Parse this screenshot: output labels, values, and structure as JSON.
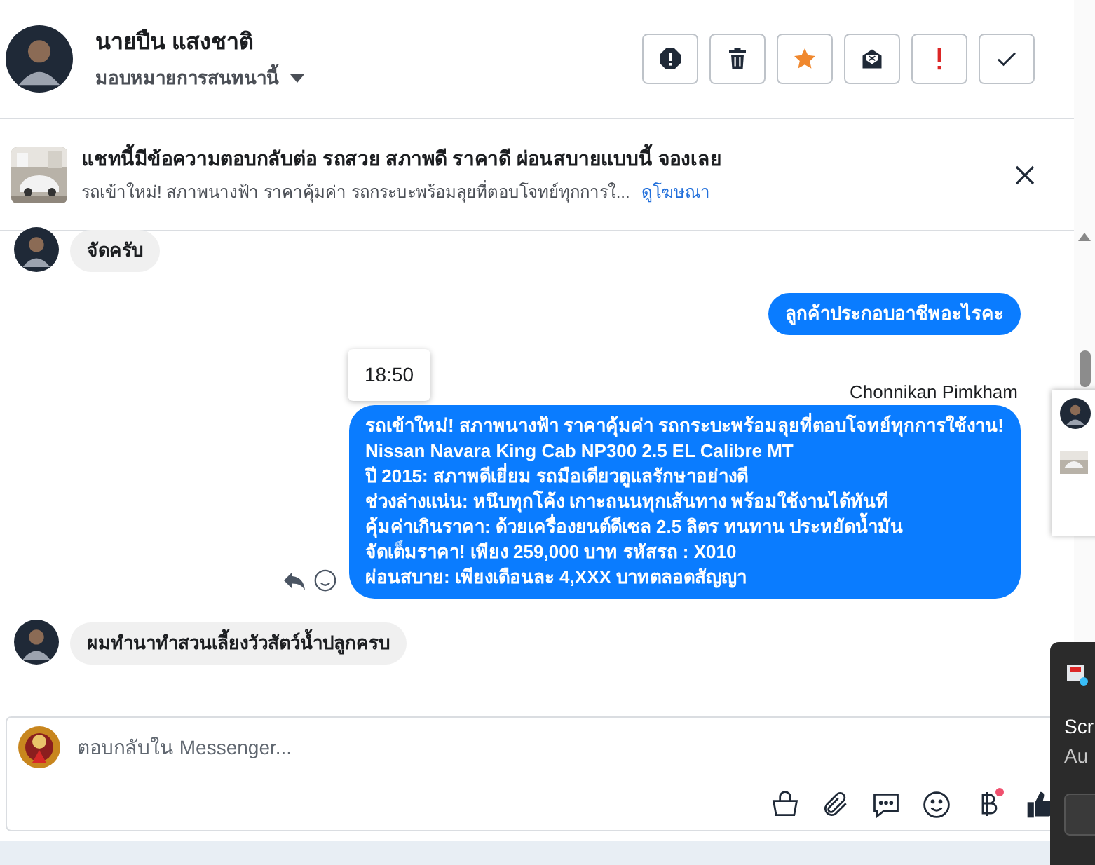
{
  "header": {
    "name": "นายปืน แสงชาติ",
    "assign": "มอบหมายการสนทนานี้"
  },
  "actions": [
    {
      "kind": "spam"
    },
    {
      "kind": "delete"
    },
    {
      "kind": "star"
    },
    {
      "kind": "unread"
    },
    {
      "kind": "important"
    },
    {
      "kind": "done"
    }
  ],
  "ad": {
    "title": "แชทนี้มีข้อความตอบกลับต่อ รถสวย สภาพดี ราคาดี ผ่อนสบายแบบนี้ จองเลย",
    "body": "รถเข้าใหม่! สภาพนางฟ้า ราคาคุ้มค่า รถกระบะพร้อมลุยที่ตอบโจทย์ทุกการใ...",
    "link": "ดูโฆษณา"
  },
  "messages": [
    {
      "outgoing": false,
      "lines": [
        "จัดครับ"
      ]
    },
    {
      "outgoing": true,
      "lines": [
        "ลูกค้าประกอบอาชีพอะไรคะ"
      ]
    },
    {
      "outgoing": true,
      "time": "18:50",
      "sender": "Chonnikan Pimkham",
      "lines": [
        "รถเข้าใหม่! สภาพนางฟ้า ราคาคุ้มค่า รถกระบะพร้อมลุยที่ตอบโจทย์ทุกการใช้งาน!",
        "Nissan Navara King Cab NP300 2.5 EL Calibre MT",
        "ปี 2015: สภาพดีเยี่ยม รถมือเดียวดูแลรักษาอย่างดี",
        "ช่วงล่างแน่น: หนึบทุกโค้ง เกาะถนนทุกเส้นทาง พร้อมใช้งานได้ทันที",
        "คุ้มค่าเกินราคา: ด้วยเครื่องยนต์ดีเซล 2.5 ลิตร ทนทาน ประหยัดน้ำมัน",
        "จัดเต็มราคา! เพียง 259,000 บาท  รหัสรถ : X010",
        "ผ่อนสบาย: เพียงเดือนละ 4,XXX บาทตลอดสัญญา"
      ]
    },
    {
      "outgoing": false,
      "lines": [
        "ผมทำนาทำสวนเลี้ยงวัวสัตว์น้ำปลูกครบ"
      ]
    }
  ],
  "composer": {
    "placeholder": "ตอบกลับใน Messenger...",
    "tools": [
      {
        "kind": "bag"
      },
      {
        "kind": "clip"
      },
      {
        "kind": "chat"
      },
      {
        "kind": "smile"
      },
      {
        "kind": "baht",
        "dot": true
      },
      {
        "kind": "like"
      }
    ]
  },
  "toast": {
    "title": "Scr",
    "body": "Au"
  }
}
